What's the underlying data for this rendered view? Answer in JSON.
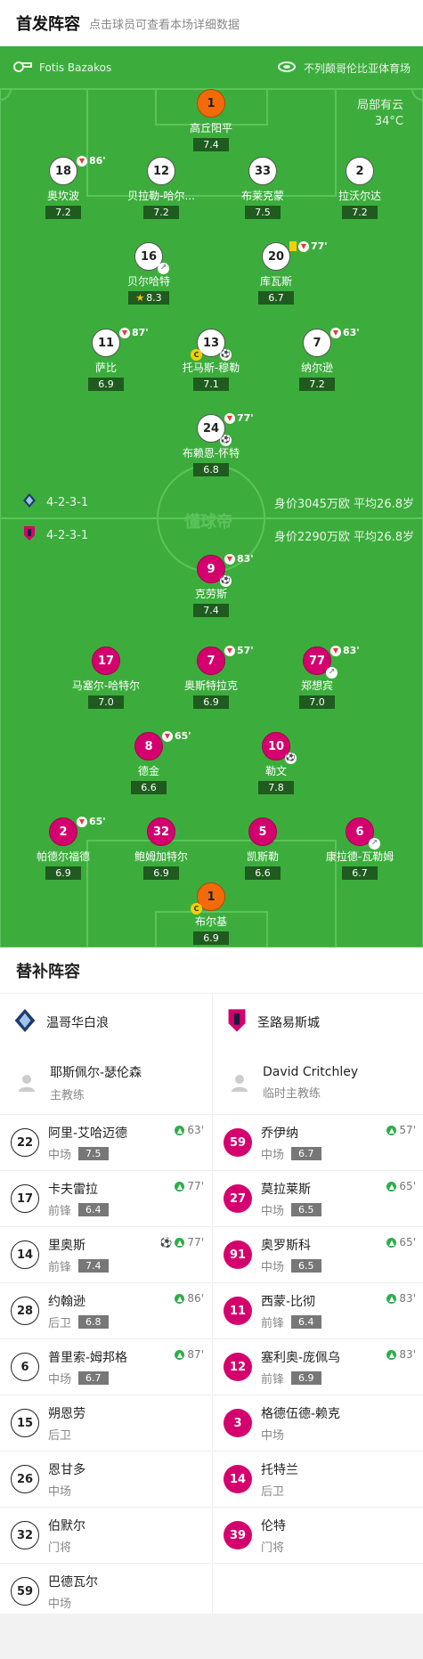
{
  "header": {
    "title": "首发阵容",
    "subtitle": "点击球员可查看本场详细数据"
  },
  "match_info": {
    "referee_icon": "whistle-icon",
    "referee": "Fotis Bazakos",
    "stadium_icon": "stadium-icon",
    "stadium": "不列颠哥伦比亚体育场",
    "weather": "局部有云",
    "temperature": "34°C"
  },
  "watermark": "懂球帝",
  "home_team": {
    "formation": "4-2-3-1",
    "value_text": "身价3045万欧 平均26.8岁",
    "players": [
      {
        "num": "1",
        "name": "高丘阳平",
        "rating": "7.4",
        "gk": true
      },
      {
        "num": "18",
        "name": "奥坎波",
        "rating": "7.2",
        "sub_min": "86'"
      },
      {
        "num": "12",
        "name": "贝拉勒-哈尔...",
        "rating": "7.2"
      },
      {
        "num": "33",
        "name": "布莱克蒙",
        "rating": "7.5"
      },
      {
        "num": "2",
        "name": "拉沃尔达",
        "rating": "7.2"
      },
      {
        "num": "16",
        "name": "贝尔哈特",
        "rating": "8.3",
        "assist": true,
        "star": true
      },
      {
        "num": "20",
        "name": "库瓦斯",
        "rating": "6.7",
        "sub_min": "77'",
        "yellow": true
      },
      {
        "num": "11",
        "name": "萨比",
        "rating": "6.9",
        "sub_min": "87'"
      },
      {
        "num": "13",
        "name": "托马斯-穆勒",
        "rating": "7.1",
        "captain": true,
        "goal": true
      },
      {
        "num": "7",
        "name": "纳尔逊",
        "rating": "7.2",
        "sub_min": "63'"
      },
      {
        "num": "24",
        "name": "布赖恩-怀特",
        "rating": "6.8",
        "sub_min": "77'",
        "goal": true
      }
    ]
  },
  "away_team": {
    "formation": "4-2-3-1",
    "value_text": "身价2290万欧 平均26.8岁",
    "players": [
      {
        "num": "9",
        "name": "克劳斯",
        "rating": "7.4",
        "sub_min": "83'",
        "goal": true
      },
      {
        "num": "17",
        "name": "马塞尔-哈特尔",
        "rating": "7.0"
      },
      {
        "num": "7",
        "name": "奥斯特拉克",
        "rating": "6.9",
        "sub_min": "57'"
      },
      {
        "num": "77",
        "name": "郑想宾",
        "rating": "7.0",
        "sub_min": "83'",
        "assist": true
      },
      {
        "num": "8",
        "name": "德金",
        "rating": "6.6",
        "sub_min": "65'"
      },
      {
        "num": "10",
        "name": "勒文",
        "rating": "7.8",
        "goal": true
      },
      {
        "num": "2",
        "name": "帕德尔福德",
        "rating": "6.9",
        "sub_min": "65'"
      },
      {
        "num": "32",
        "name": "鲍姆加特尔",
        "rating": "6.9"
      },
      {
        "num": "5",
        "name": "凯斯勒",
        "rating": "6.6"
      },
      {
        "num": "6",
        "name": "康拉德-瓦勒姆",
        "rating": "6.7",
        "assist": true
      },
      {
        "num": "1",
        "name": "布尔基",
        "rating": "6.9",
        "gk": true,
        "captain": true
      }
    ]
  },
  "subs": {
    "title": "替补阵容",
    "home": {
      "team": "温哥华白浪",
      "coach": "耶斯佩尔-瑟伦森",
      "coach_role": "主教练",
      "players": [
        {
          "num": "22",
          "name": "阿里-艾哈迈德",
          "pos": "中场",
          "rating": "7.5",
          "time": "63'"
        },
        {
          "num": "17",
          "name": "卡夫雷拉",
          "pos": "前锋",
          "rating": "6.4",
          "time": "77'"
        },
        {
          "num": "14",
          "name": "里奥斯",
          "pos": "前锋",
          "rating": "7.4",
          "time": "77'",
          "goal": true
        },
        {
          "num": "28",
          "name": "约翰逊",
          "pos": "后卫",
          "rating": "6.8",
          "time": "86'"
        },
        {
          "num": "6",
          "name": "普里索-姆邦格",
          "pos": "中场",
          "rating": "6.7",
          "time": "87'"
        },
        {
          "num": "15",
          "name": "朔恩劳",
          "pos": "后卫"
        },
        {
          "num": "26",
          "name": "恩甘多",
          "pos": "中场"
        },
        {
          "num": "32",
          "name": "伯默尔",
          "pos": "门将"
        },
        {
          "num": "59",
          "name": "巴德瓦尔",
          "pos": "中场"
        }
      ]
    },
    "away": {
      "team": "圣路易斯城",
      "coach": "David Critchley",
      "coach_role": "临时主教练",
      "players": [
        {
          "num": "59",
          "name": "乔伊纳",
          "pos": "中场",
          "rating": "6.7",
          "time": "57'"
        },
        {
          "num": "27",
          "name": "莫拉莱斯",
          "pos": "中场",
          "rating": "6.5",
          "time": "65'"
        },
        {
          "num": "91",
          "name": "奥罗斯科",
          "pos": "中场",
          "rating": "6.5",
          "time": "65'"
        },
        {
          "num": "11",
          "name": "西蒙-比彻",
          "pos": "前锋",
          "rating": "6.4",
          "time": "83'"
        },
        {
          "num": "12",
          "name": "塞利奥-庞佩乌",
          "pos": "前锋",
          "rating": "6.9",
          "time": "83'"
        },
        {
          "num": "3",
          "name": "格德伍德-赖克",
          "pos": "中场"
        },
        {
          "num": "14",
          "name": "托特兰",
          "pos": "后卫"
        },
        {
          "num": "39",
          "name": "伦特",
          "pos": "门将"
        }
      ]
    }
  }
}
